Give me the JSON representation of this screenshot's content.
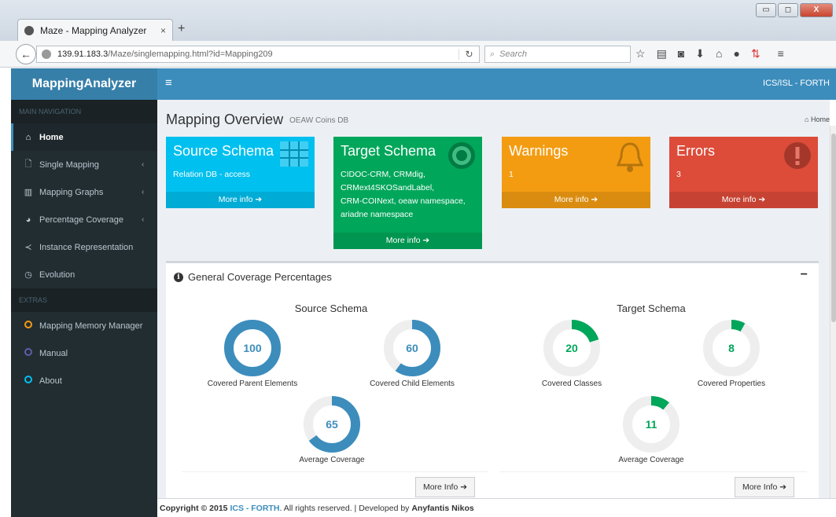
{
  "browser": {
    "tab_title": "Maze - Mapping Analyzer",
    "tab_close": "×",
    "new_tab": "+",
    "url_host": "139.91.183.3",
    "url_path": "/Maze/singlemapping.html?id=Mapping209",
    "search_placeholder": "Search",
    "window_buttons": [
      "▭",
      "◻",
      "X"
    ],
    "toolbar_icons": [
      "star-icon",
      "reading-list-icon",
      "pocket-icon",
      "download-icon",
      "home-icon",
      "chat-icon",
      "sync-icon",
      "menu-icon"
    ]
  },
  "header": {
    "logo": "MappingAnalyzer",
    "menu_toggle": "≡",
    "org": "ICS/ISL - FORTH"
  },
  "sidebar": {
    "main_nav_header": "MAIN NAVIGATION",
    "items": [
      {
        "label": "Home",
        "icon": "home-icon",
        "glyph": "⌂",
        "active": true,
        "chevron": ""
      },
      {
        "label": "Single Mapping",
        "icon": "file-icon",
        "glyph": "🗋",
        "active": false,
        "chevron": "‹"
      },
      {
        "label": "Mapping Graphs",
        "icon": "bar-chart-icon",
        "glyph": "▥",
        "active": false,
        "chevron": "‹"
      },
      {
        "label": "Percentage Coverage",
        "icon": "pie-chart-icon",
        "glyph": "◕",
        "active": false,
        "chevron": "‹"
      },
      {
        "label": "Instance Representation",
        "icon": "share-icon",
        "glyph": "≺",
        "active": false,
        "chevron": ""
      },
      {
        "label": "Evolution",
        "icon": "clock-icon",
        "glyph": "◷",
        "active": false,
        "chevron": ""
      }
    ],
    "extras_header": "EXTRAS",
    "extras": [
      {
        "label": "Mapping Memory Manager",
        "color": "#f39c12"
      },
      {
        "label": "Manual",
        "color": "#605ca8"
      },
      {
        "label": "About",
        "color": "#00c0ef"
      }
    ]
  },
  "page": {
    "title": "Mapping Overview",
    "subtitle": "OEAW Coins DB",
    "breadcrumb": "Home"
  },
  "boxes": [
    {
      "title": "Source Schema",
      "lines": [
        "Relation DB - access"
      ],
      "footer": "More info ➔",
      "color": "#00c0ef"
    },
    {
      "title": "Target Schema",
      "lines": [
        "CIDOC-CRM, CRMdig,",
        "CRMext4SKOSandLabel,",
        "CRM-COINext, oeaw namespace,",
        "ariadne namespace"
      ],
      "footer": "More info ➔",
      "color": "#00a65a"
    },
    {
      "title": "Warnings",
      "lines": [
        "1"
      ],
      "footer": "More info ➔",
      "color": "#f39c12"
    },
    {
      "title": "Errors",
      "lines": [
        "3"
      ],
      "footer": "More info ➔",
      "color": "#dd4b39"
    }
  ],
  "coverage": {
    "panel_title": "General Coverage Percentages",
    "collapse": "−",
    "source_title": "Source Schema",
    "target_title": "Target Schema",
    "source_donuts": [
      {
        "value": 100,
        "label": "Covered Parent Elements",
        "color": "#3c8dbc"
      },
      {
        "value": 60,
        "label": "Covered Child Elements",
        "color": "#3c8dbc"
      },
      {
        "value": 65,
        "label": "Average Coverage",
        "color": "#3c8dbc"
      }
    ],
    "target_donuts": [
      {
        "value": 20,
        "label": "Covered Classes",
        "color": "#00a65a"
      },
      {
        "value": 8,
        "label": "Covered Properties",
        "color": "#00a65a"
      },
      {
        "value": 11,
        "label": "Average Coverage",
        "color": "#00a65a"
      }
    ],
    "more_info": "More Info ➔"
  },
  "footer": {
    "copyright": "Copyright © 2015",
    "org_link": "ICS - FORTH",
    "rights": ". All rights reserved. | Developed by",
    "author": "Anyfantis Nikos"
  }
}
